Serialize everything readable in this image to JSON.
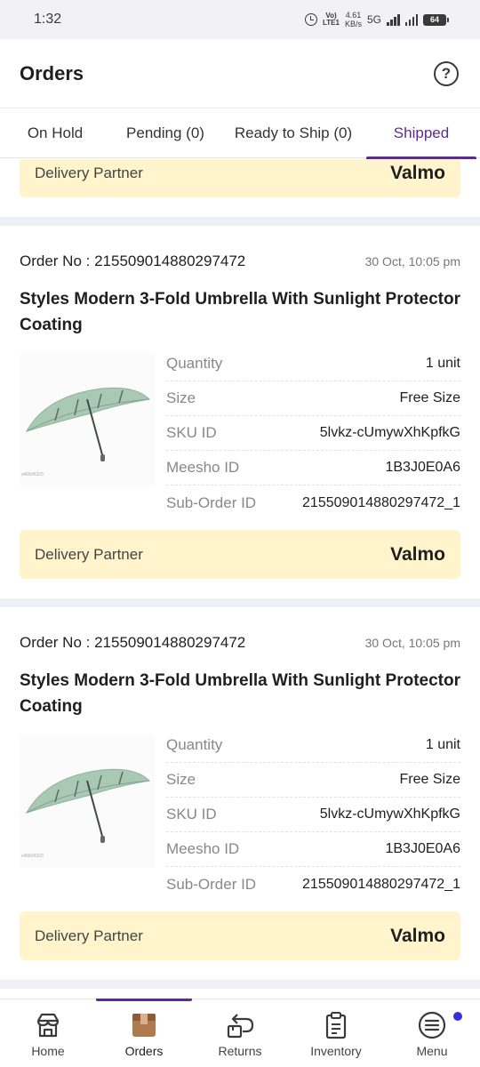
{
  "status_bar": {
    "time": "1:32",
    "network_top": "Vo)",
    "network_bottom": "LTE1",
    "speed_top": "4.61",
    "speed_bottom": "KB/s",
    "network_type": "5G",
    "battery": "64"
  },
  "header": {
    "title": "Orders",
    "help_icon": "help-circle-icon"
  },
  "tabs": [
    {
      "label": "On Hold",
      "active": false
    },
    {
      "label": "Pending (0)",
      "active": false
    },
    {
      "label": "Ready to Ship (0)",
      "active": false
    },
    {
      "label": "Shipped",
      "active": true
    }
  ],
  "top_partner": {
    "label": "Delivery Partner",
    "value": "Valmo"
  },
  "orders": [
    {
      "order_no": "Order No : 215509014880297472",
      "date": "30 Oct, 10:05 pm",
      "title": "Styles Modern 3-Fold Umbrella With Sunlight Protector Coating",
      "image": "umbrella-product-image",
      "image_caption": "s466#6323",
      "details": [
        {
          "key": "Quantity",
          "value": "1 unit"
        },
        {
          "key": "Size",
          "value": "Free Size"
        },
        {
          "key": "SKU ID",
          "value": "5lvkz-cUmywXhKpfkG"
        },
        {
          "key": "Meesho ID",
          "value": "1B3J0E0A6"
        },
        {
          "key": "Sub-Order ID",
          "value": "215509014880297472_1"
        }
      ],
      "partner_label": "Delivery Partner",
      "partner_value": "Valmo"
    },
    {
      "order_no": "Order No : 215509014880297472",
      "date": "30 Oct, 10:05 pm",
      "title": "Styles Modern 3-Fold Umbrella With Sunlight Protector Coating",
      "image": "umbrella-product-image",
      "image_caption": "s466#6323",
      "details": [
        {
          "key": "Quantity",
          "value": "1 unit"
        },
        {
          "key": "Size",
          "value": "Free Size"
        },
        {
          "key": "SKU ID",
          "value": "5lvkz-cUmywXhKpfkG"
        },
        {
          "key": "Meesho ID",
          "value": "1B3J0E0A6"
        },
        {
          "key": "Sub-Order ID",
          "value": "215509014880297472_1"
        }
      ],
      "partner_label": "Delivery Partner",
      "partner_value": "Valmo"
    }
  ],
  "bottom_nav": [
    {
      "label": "Home",
      "icon": "home-icon",
      "active": false
    },
    {
      "label": "Orders",
      "icon": "orders-box-icon",
      "active": true
    },
    {
      "label": "Returns",
      "icon": "returns-icon",
      "active": false
    },
    {
      "label": "Inventory",
      "icon": "inventory-clipboard-icon",
      "active": false
    },
    {
      "label": "Menu",
      "icon": "menu-icon",
      "active": false,
      "badge_dot": true
    }
  ],
  "colors": {
    "accent": "#5c2d91",
    "partner_bg": "#fff4cc",
    "separator": "#eef0f5",
    "menu_dot": "#3b2fd6"
  }
}
